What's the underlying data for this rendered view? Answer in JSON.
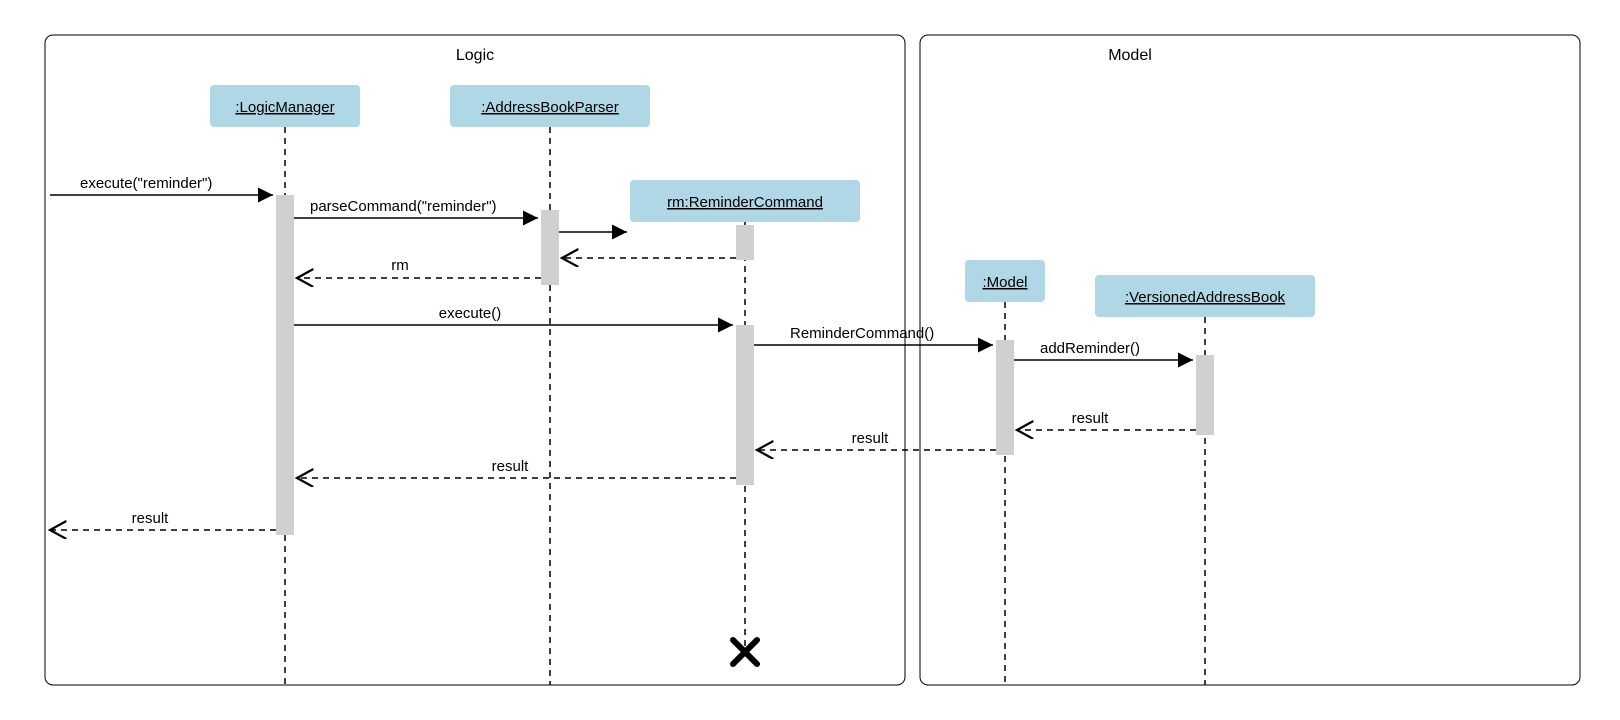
{
  "frames": {
    "logic": "Logic",
    "model": "Model"
  },
  "lifelines": {
    "logicManager": ":LogicManager",
    "addressBookParser": ":AddressBookParser",
    "reminderCommand": "rm:ReminderCommand",
    "model": ":Model",
    "versionedAddressBook": ":VersionedAddressBook"
  },
  "messages": {
    "executeReminder": "execute(\"reminder\")",
    "parseCommand": "parseCommand(\"reminder\")",
    "rm": "rm",
    "execute": "execute()",
    "reminderCommandCall": "ReminderCommand()",
    "addReminder": "addReminder()",
    "result1": "result",
    "result2": "result",
    "result3": "result",
    "result4": "result"
  }
}
